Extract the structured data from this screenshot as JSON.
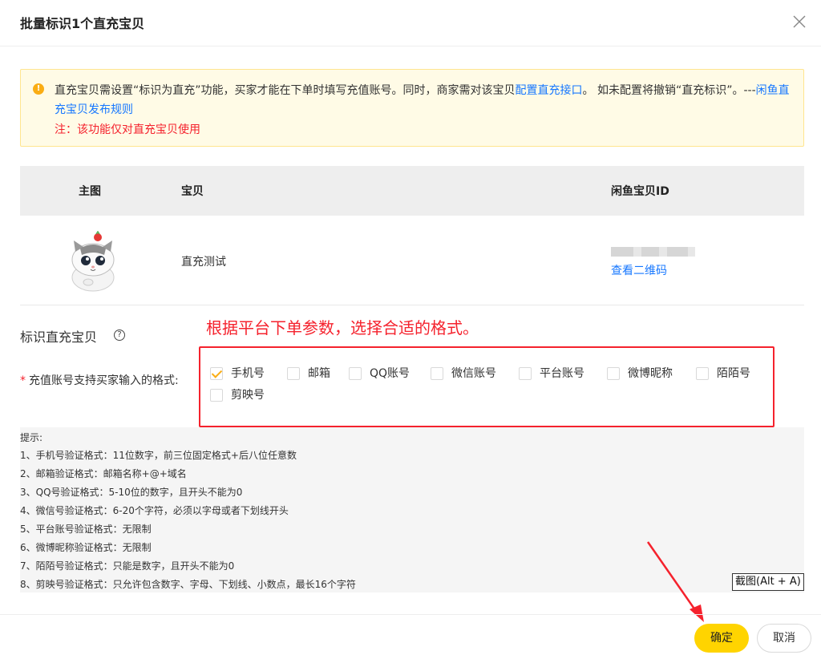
{
  "dialog": {
    "title": "批量标识1个直充宝贝",
    "close_icon": "close-icon"
  },
  "notice": {
    "icon": "warning-icon",
    "text_1": "直充宝贝需设置“标识为直充”功能，买家才能在下单时填写充值账号。同时，商家需对该宝贝",
    "link_config": "配置直充接口",
    "text_2": "。 如未配置将撤销“直充标识”。---",
    "link_rules": "闲鱼直充宝贝发布规则",
    "red_note": "注：该功能仅对直充宝贝使用"
  },
  "table": {
    "headers": [
      "主图",
      "宝贝",
      "闲鱼宝贝ID"
    ],
    "row": {
      "name": "直充测试",
      "qr_link": "查看二维码"
    }
  },
  "section": {
    "label": "标识直充宝贝",
    "help_icon": "question-circle-icon"
  },
  "annotation": {
    "hint": "根据平台下单参数，选择合适的格式。"
  },
  "formats": {
    "label": "充值账号支持买家输入的格式:",
    "required_mark": "*",
    "options": [
      {
        "label": "手机号",
        "checked": true
      },
      {
        "label": "邮箱",
        "checked": false
      },
      {
        "label": "QQ账号",
        "checked": false
      },
      {
        "label": "微信账号",
        "checked": false
      },
      {
        "label": "平台账号",
        "checked": false
      },
      {
        "label": "微博昵称",
        "checked": false
      },
      {
        "label": "陌陌号",
        "checked": false
      },
      {
        "label": "剪映号",
        "checked": false
      }
    ]
  },
  "tips": {
    "lines": [
      "提示:",
      "1、手机号验证格式：11位数字，前三位固定格式+后八位任意数",
      "2、邮箱验证格式：邮箱名称+@+域名",
      "3、QQ号验证格式：5-10位的数字，且开头不能为0",
      "4、微信号验证格式：6-20个字符，必须以字母或者下划线开头",
      "5、平台账号验证格式：无限制",
      "6、微博昵称验证格式：无限制",
      "7、陌陌号验证格式：只能是数字，且开头不能为0",
      "8、剪映号验证格式：只允许包含数字、字母、下划线、小数点，最长16个字符"
    ]
  },
  "screenshot_tag": "截图(Alt + A)",
  "footer": {
    "ok": "确定",
    "cancel": "取消"
  },
  "colors": {
    "accent": "#ffd400",
    "link": "#1677ff",
    "danger": "#f5222d",
    "warning": "#faad14"
  }
}
